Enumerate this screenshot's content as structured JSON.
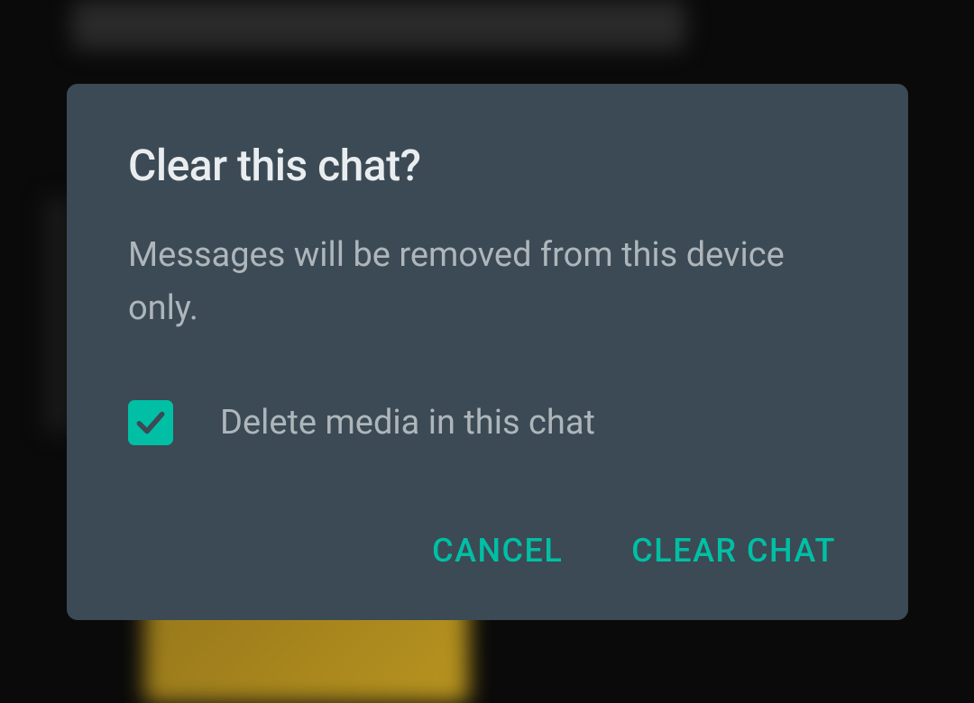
{
  "dialog": {
    "title": "Clear this chat?",
    "message": "Messages will be removed from this device only.",
    "checkbox": {
      "label": "Delete media in this chat",
      "checked": true
    },
    "buttons": {
      "cancel": "CANCEL",
      "confirm": "CLEAR CHAT"
    }
  },
  "colors": {
    "accent": "#00bfa5",
    "dialog_bg": "#3b4a54",
    "text_primary": "#e9edef",
    "text_secondary": "#aeb6bb"
  }
}
